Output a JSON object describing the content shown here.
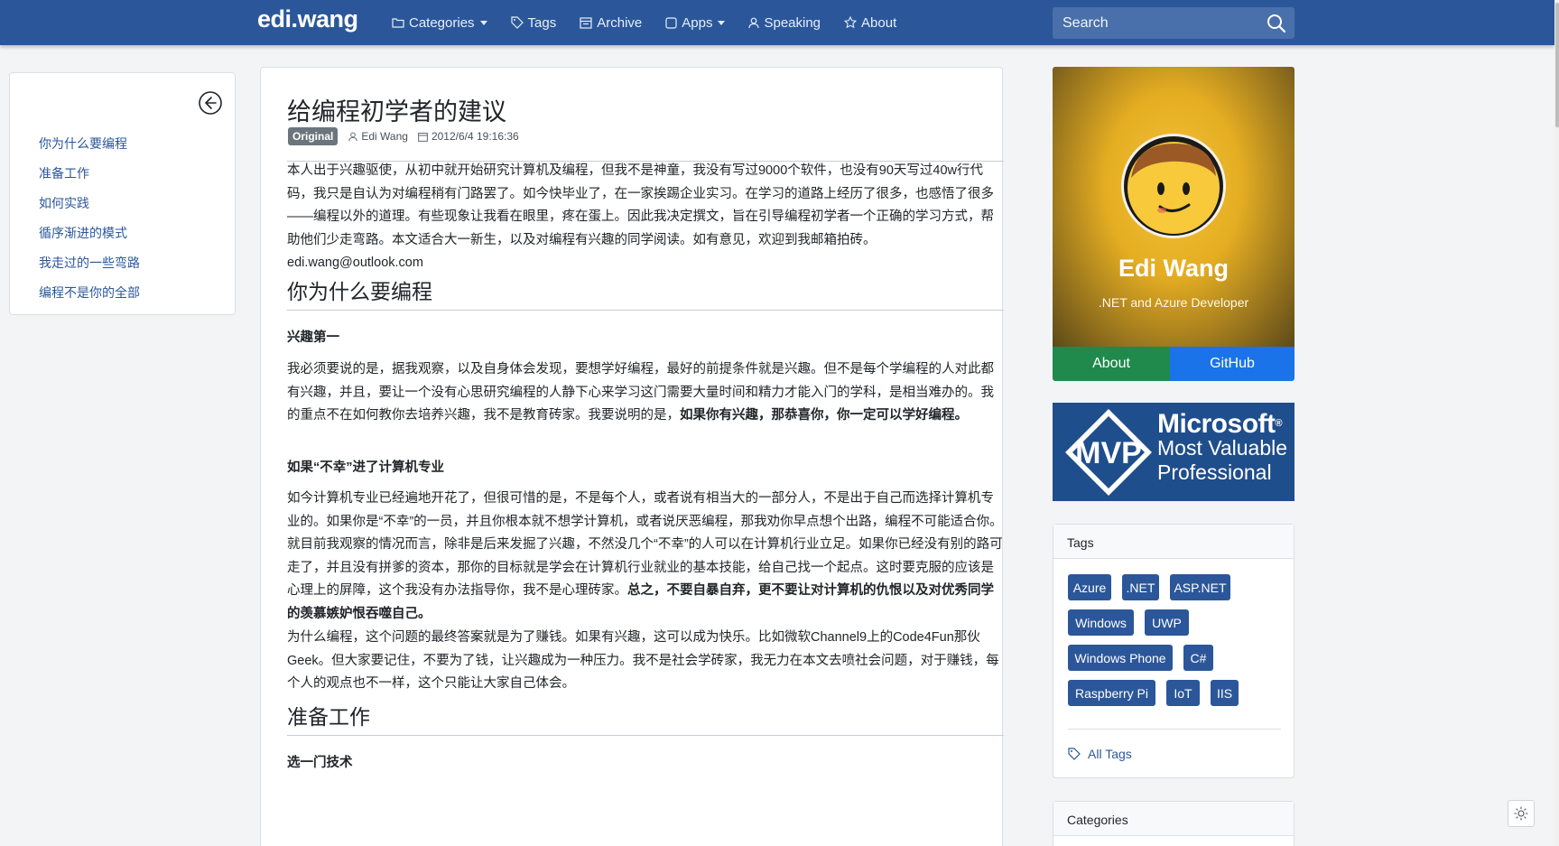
{
  "nav": {
    "brand": "edi.wang",
    "items": [
      {
        "label": "Categories",
        "icon": "folder-icon",
        "dropdown": true
      },
      {
        "label": "Tags",
        "icon": "tag-icon",
        "dropdown": false
      },
      {
        "label": "Archive",
        "icon": "archive-icon",
        "dropdown": false
      },
      {
        "label": "Apps",
        "icon": "square-icon",
        "dropdown": true
      },
      {
        "label": "Speaking",
        "icon": "person-icon",
        "dropdown": false
      },
      {
        "label": "About",
        "icon": "star-icon",
        "dropdown": false
      }
    ],
    "search_placeholder": "Search"
  },
  "toc": {
    "items": [
      "你为什么要编程",
      "准备工作",
      "如何实践",
      "循序渐进的模式",
      "我走过的一些弯路",
      "编程不是你的全部"
    ]
  },
  "post": {
    "title": "给编程初学者的建议",
    "badge": "Original",
    "author": "Edi Wang",
    "date": "2012/6/4 19:16:36",
    "intro": "本人出于兴趣驱使，从初中就开始研究计算机及编程，但我不是神童，我没有写过9000个软件，也没有90天写过40w行代码，我只是自认为对编程稍有门路罢了。如今快毕业了，在一家挨踢企业实习。在学习的道路上经历了很多，也感悟了很多——编程以外的道理。有些现象让我看在眼里，疼在蛋上。因此我决定撰文，旨在引导编程初学者一个正确的学习方式，帮助他们少走弯路。本文适合大一新生，以及对编程有兴趣的同学阅读。如有意见，欢迎到我邮箱拍砖。edi.wang@outlook.com",
    "h2_1": "你为什么要编程",
    "h4_1": "兴趣第一",
    "p1": "我必须要说的是，据我观察，以及自身体会发现，要想学好编程，最好的前提条件就是兴趣。但不是每个学编程的人对此都有兴趣，并且，要让一个没有心思研究编程的人静下心来学习这门需要大量时间和精力才能入门的学科，是相当难办的。我的重点不在如何教你去培养兴趣，我不是教育砖家。我要说明的是，",
    "p1_bold": "如果你有兴趣，那恭喜你，你一定可以学好编程。",
    "h4_2": "如果“不幸”进了计算机专业",
    "p2": "如今计算机专业已经遍地开花了，但很可惜的是，不是每个人，或者说有相当大的一部分人，不是出于自己而选择计算机专业的。如果你是“不幸”的一员，并且你根本就不想学计算机，或者说厌恶编程，那我劝你早点想个出路，编程不可能适合你。就目前我观察的情况而言，除非是后来发掘了兴趣，不然没几个“不幸”的人可以在计算机行业立足。如果你已经没有别的路可走了，并且没有拼爹的资本，那你的目标就是学会在计算机行业就业的基本技能，给自己找一个起点。这时要克服的应该是心理上的屏障，这个我没有办法指导你，我不是心理砖家。",
    "p2_bold": "总之，不要自暴自弃，更不要让对计算机的仇恨以及对优秀同学的羡慕嫉妒恨吞噬自己。",
    "p3": "为什么编程，这个问题的最终答案就是为了赚钱。如果有兴趣，这可以成为快乐。比如微软Channel9上的Code4Fun那伙Geek。但大家要记住，不要为了钱，让兴趣成为一种压力。我不是社会学砖家，我无力在本文去喷社会问题，对于赚钱，每个人的观点也不一样，这个只能让大家自己体会。",
    "h2_2": "准备工作",
    "h4_3": "选一门技术"
  },
  "profile": {
    "name": "Edi Wang",
    "role": ".NET and Azure Developer",
    "about_label": "About",
    "github_label": "GitHub"
  },
  "mvp": {
    "badge_text": "MVP",
    "line1": "Microsoft",
    "line2": "Most Valuable",
    "line3": "Professional",
    "reg": "®"
  },
  "tags": {
    "title": "Tags",
    "items": [
      "Azure",
      ".NET",
      "ASP.NET",
      "Windows",
      "UWP",
      "Windows Phone",
      "C#",
      "Raspberry Pi",
      "IoT",
      "IIS"
    ],
    "all_label": "All Tags"
  },
  "categories": {
    "title": "Categories"
  },
  "colors": {
    "nav": "#2b579a",
    "link": "#2b579a",
    "about_btn": "#1f8a4c",
    "github_btn": "#1a73e8",
    "mvp_bg": "#1f4e8c"
  }
}
